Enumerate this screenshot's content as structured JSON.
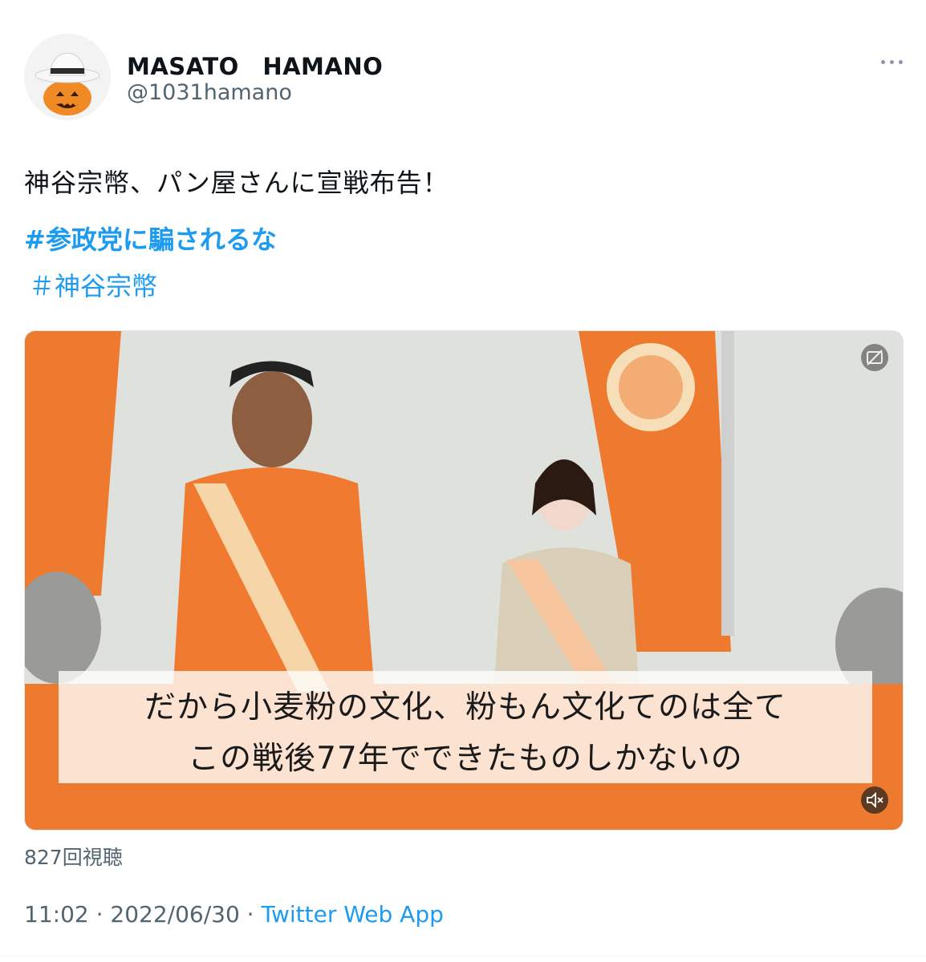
{
  "tweet": {
    "author": {
      "display_name": "MASATO　HAMANO",
      "handle": "@1031hamano",
      "avatar_icon": "pumpkin-with-hat-icon"
    },
    "more_icon": "more-icon",
    "text": "神谷宗幣、パン屋さんに宣戦布告！",
    "hashtags": [
      "#参政党に騙されるな",
      "＃神谷宗幣"
    ],
    "video": {
      "caption_lines": [
        "だから小麦粉の文化、粉もん文化てのは全て",
        "この戦後77年でできたものしかないの"
      ],
      "cc_icon": "captions-off-icon",
      "mute_icon": "muted-speaker-icon"
    },
    "view_count": "827回視聴",
    "timestamp": "11:02 · 2022/06/30 · ",
    "source_app": "Twitter Web App"
  },
  "colors": {
    "link": "#1d9bf0",
    "secondary_text": "#536471",
    "banner_orange": "#ee7a2f",
    "shirt_orange": "#f07a30"
  }
}
